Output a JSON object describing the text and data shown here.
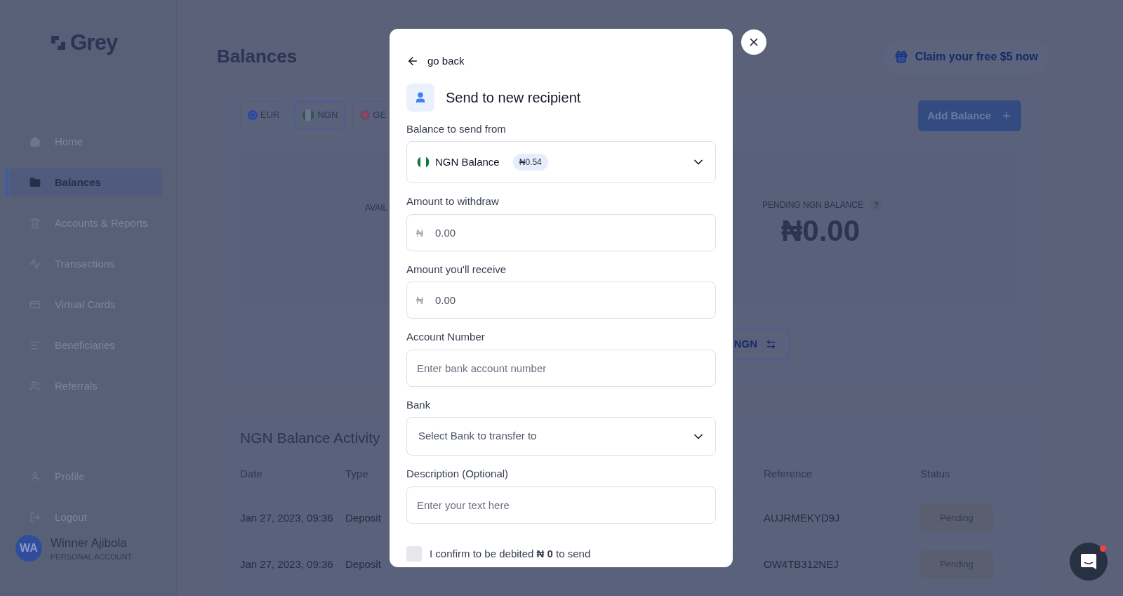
{
  "sidebar": {
    "logo": "Grey",
    "nav": [
      {
        "label": "Home",
        "selected": false
      },
      {
        "label": "Balances",
        "selected": true
      },
      {
        "label": "Accounts & Reports",
        "selected": false
      },
      {
        "label": "Transactions",
        "selected": false
      },
      {
        "label": "Virtual Cards",
        "selected": false
      },
      {
        "label": "Beneficiaries",
        "selected": false
      },
      {
        "label": "Referrals",
        "selected": false
      }
    ],
    "footer": [
      {
        "label": "Profile"
      },
      {
        "label": "Logout"
      }
    ],
    "user": {
      "initials": "WA",
      "name": "Winner Ajibola",
      "subtitle": "PERSONAL ACCOUNT"
    }
  },
  "header": {
    "title": "Balances",
    "promo": "Claim your free $5 now"
  },
  "balances": {
    "tabs": [
      {
        "label": "EUR",
        "selected": false
      },
      {
        "label": "NGN",
        "selected": true
      },
      {
        "label": "GE",
        "selected": false
      }
    ],
    "add_button": "Add Balance",
    "available_label": "AVAIL",
    "pending": {
      "label": "PENDING NGN BALANCE",
      "help": "?",
      "amount": "₦0.00"
    },
    "swap_button": "NGN"
  },
  "activity": {
    "title": "NGN Balance Activity",
    "columns": [
      "Date",
      "Type",
      "Reference",
      "Status"
    ],
    "rows": [
      {
        "date": "Jan 27, 2023, 09:36",
        "type": "Deposit",
        "reference": "AUJRMEKYD9J",
        "status": "Pending"
      },
      {
        "date": "Jan 27, 2023, 09:36",
        "type": "Deposit",
        "reference": "OW4TB312NEJ",
        "status": "Pending"
      }
    ]
  },
  "modal": {
    "back": "go back",
    "title": "Send to new recipient",
    "fields": [
      {
        "kind": "balance",
        "label": "Balance to send from",
        "value": "NGN Balance",
        "badge": "₦0.54"
      },
      {
        "kind": "amount",
        "label": "Amount to withdraw",
        "currency": "₦",
        "placeholder": "0.00"
      },
      {
        "kind": "amount",
        "label": "Amount you'll receive",
        "currency": "₦",
        "placeholder": "0.00"
      },
      {
        "kind": "text",
        "label": "Account Number",
        "placeholder": "Enter bank account number"
      },
      {
        "kind": "select",
        "label": "Bank",
        "placeholder": "Select Bank to transfer to"
      },
      {
        "kind": "text",
        "label": "Description (Optional)",
        "placeholder": "Enter your text here"
      }
    ],
    "confirm": {
      "checked": false,
      "text": "I confirm to be debited **₦ 0** to send"
    }
  }
}
